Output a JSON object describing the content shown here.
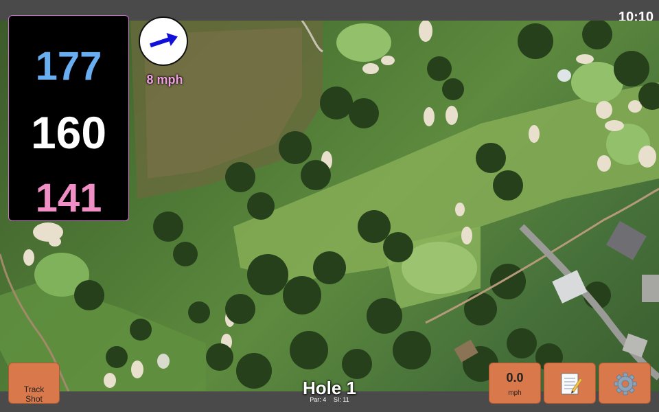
{
  "status": {
    "time": "10:10"
  },
  "distances": {
    "back": "177",
    "middle": "160",
    "front": "141"
  },
  "wind": {
    "speed_label": "8 mph",
    "direction_icon": "arrow-right-icon"
  },
  "buttons": {
    "track_shot": "Track\nShot",
    "speed_value": "0.0",
    "speed_unit": "mph",
    "notes_icon": "notepad-icon",
    "settings_icon": "gear-icon"
  },
  "hole": {
    "title": "Hole 1",
    "par": "Par: 4",
    "si": "SI: 11"
  },
  "colors": {
    "back_distance": "#6aaef2",
    "middle_distance": "#ffffff",
    "front_distance": "#f08ec6",
    "button_accent": "#d9784a",
    "wind_label": "#f0a0e0"
  }
}
